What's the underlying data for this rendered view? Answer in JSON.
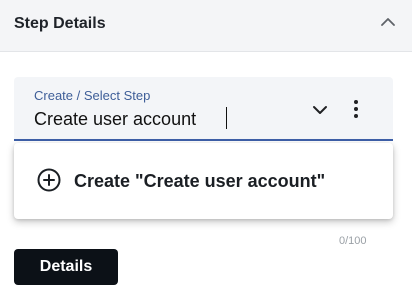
{
  "panel": {
    "title": "Step Details",
    "collapse_icon": "chevron-up-icon"
  },
  "step_field": {
    "label": "Create / Select Step",
    "value": "Create user account",
    "counter": "0/100",
    "dropdown_icon": "chevron-down-icon",
    "menu_icon": "more-vertical-icon"
  },
  "dropdown": {
    "options": [
      {
        "icon": "add-circle-icon",
        "label": "Create \"Create user account\""
      }
    ]
  },
  "actions": {
    "details_label": "Details"
  },
  "colors": {
    "header_bg": "#f4f5f7",
    "field_bg": "#f3f5f8",
    "accent": "#3d5fa8",
    "button_bg": "#0c1117"
  }
}
